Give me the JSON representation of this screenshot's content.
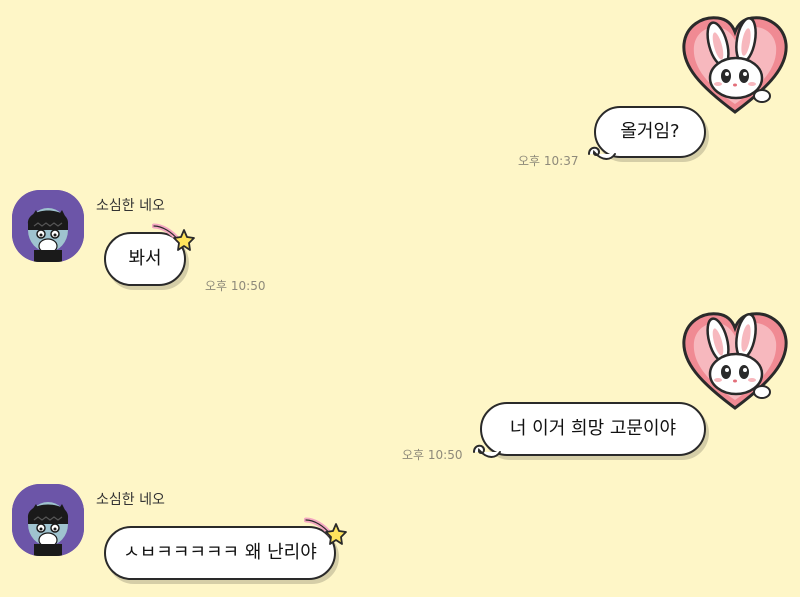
{
  "chat": {
    "messages": [
      {
        "from": "me",
        "type": "sticker",
        "sticker_icon": "heart-bunny-sticker-icon"
      },
      {
        "from": "me",
        "type": "text",
        "text": "올거임?",
        "time": "오후 10:37"
      },
      {
        "from": "other",
        "sender": "소심한 네오",
        "type": "text",
        "text": "봐서",
        "time": "오후 10:50"
      },
      {
        "from": "me",
        "type": "sticker",
        "sticker_icon": "heart-bunny-sticker-icon"
      },
      {
        "from": "me",
        "type": "text",
        "text": "너 이거 희망 고문이야",
        "time": "오후 10:50"
      },
      {
        "from": "other",
        "sender": "소심한 네오",
        "type": "text",
        "text": "ㅅㅂㅋㅋㅋㅋㅋ 왜 난리야"
      }
    ]
  },
  "colors": {
    "background": "#FEF6C7",
    "bubble": "#FFFFFF",
    "bubble_border": "#2A2A2A",
    "avatar": "#6C55A8",
    "heart": "#F08A93"
  }
}
